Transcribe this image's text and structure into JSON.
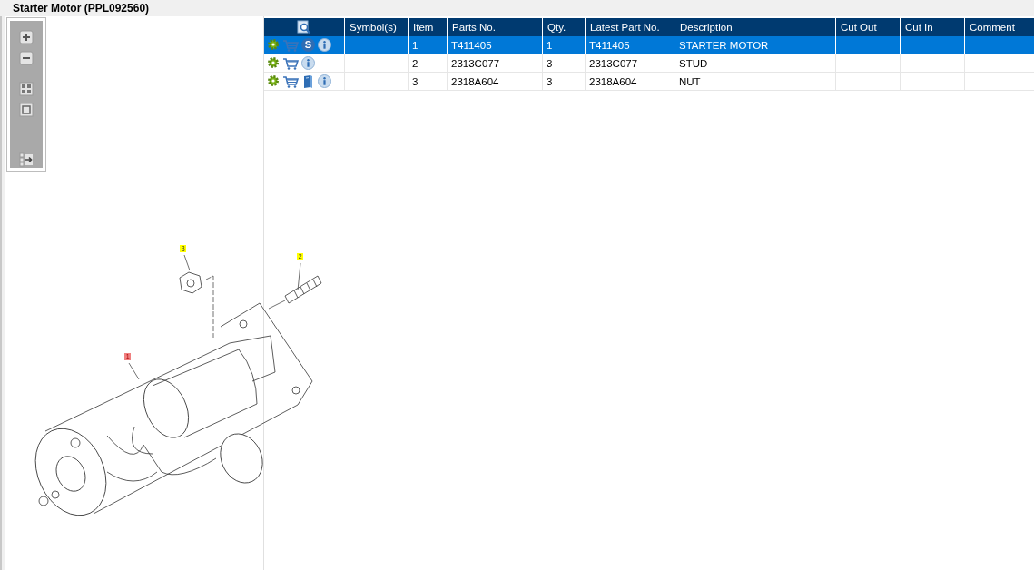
{
  "title": "Starter Motor (PPL092560)",
  "callouts": [
    {
      "label": "3",
      "selected": false
    },
    {
      "label": "2",
      "selected": false
    },
    {
      "label": "1",
      "selected": true
    }
  ],
  "table": {
    "columns": [
      "Symbol(s)",
      "Item",
      "Parts No.",
      "Qty.",
      "Latest Part No.",
      "Description",
      "Cut Out",
      "Cut In",
      "Comment"
    ],
    "rows": [
      {
        "selected": true,
        "badge": "S",
        "document": false,
        "cells": [
          "",
          "1",
          "T411405",
          "1",
          "T411405",
          "STARTER MOTOR",
          "",
          "",
          ""
        ]
      },
      {
        "selected": false,
        "document": false,
        "cells": [
          "",
          "2",
          "2313C077",
          "3",
          "2313C077",
          "STUD",
          "",
          "",
          ""
        ]
      },
      {
        "selected": false,
        "document": true,
        "cells": [
          "",
          "3",
          "2318A604",
          "3",
          "2318A604",
          "NUT",
          "",
          "",
          ""
        ]
      }
    ]
  }
}
